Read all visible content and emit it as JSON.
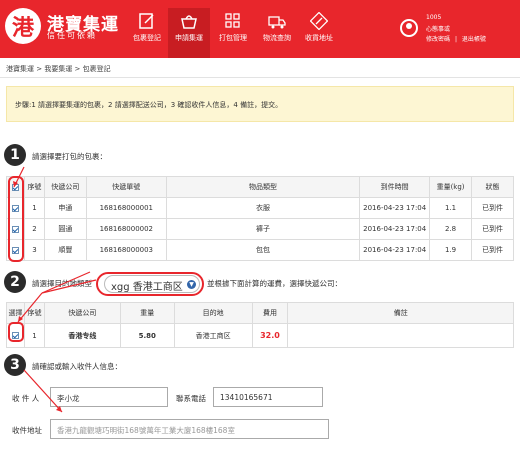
{
  "header": {
    "logo_glyph": "港",
    "logo_title": "港寶集運",
    "logo_subtitle": "信任可依賴",
    "nav": [
      {
        "label": "包裹登記",
        "icon": "edit-icon"
      },
      {
        "label": "申請集運",
        "icon": "basket-icon",
        "active": true
      },
      {
        "label": "打包管理",
        "icon": "grid-icon"
      },
      {
        "label": "物流查詢",
        "icon": "truck-icon"
      },
      {
        "label": "收貨地址",
        "icon": "address-icon"
      }
    ],
    "user": {
      "id": "1005",
      "name": "心態事或",
      "edit_link": "修改密碼",
      "separator": "|",
      "logout_link": "退出帳號"
    }
  },
  "breadcrumb": "港寶集運 > 我要集運 > 包裹登記",
  "notice": "步驟:1 請選擇要集運的包裹，2 請選擇配送公司，3 確認收件人信息，4 備註，提交。",
  "step1": {
    "number": "1",
    "title": "請選擇要打包的包裹：",
    "columns": [
      "",
      "序號",
      "快遞公司",
      "快遞單號",
      "物品類型",
      "到件時間",
      "重量(kg)",
      "狀態"
    ],
    "rows": [
      {
        "checked": true,
        "seq": "1",
        "company": "申通",
        "tracking": "168168000001",
        "type": "衣服",
        "time": "2016-04-23 17:04",
        "weight": "1.1",
        "status": "已到件"
      },
      {
        "checked": true,
        "seq": "2",
        "company": "圓通",
        "tracking": "168168000002",
        "type": "褲子",
        "time": "2016-04-23 17:04",
        "weight": "2.8",
        "status": "已到件"
      },
      {
        "checked": true,
        "seq": "3",
        "company": "順豐",
        "tracking": "168168000003",
        "type": "包包",
        "time": "2016-04-23 17:04",
        "weight": "1.9",
        "status": "已到件"
      }
    ]
  },
  "step2": {
    "number": "2",
    "title_prefix": "請選擇目的地類型",
    "select_value": "xgg 香港工商区",
    "title_suffix": "並根據下面計算的運費，選擇快遞公司：",
    "columns": [
      "選擇",
      "序號",
      "快遞公司",
      "重量",
      "目的地",
      "費用",
      "備註"
    ],
    "rows": [
      {
        "checked": true,
        "seq": "1",
        "company": "香港专线",
        "weight": "5.80",
        "destination": "香港工商区",
        "fee": "32.0",
        "note": ""
      }
    ]
  },
  "step3": {
    "number": "3",
    "title": "請確認或輸入收件人信息：",
    "recipient_label": "收 件 人",
    "recipient_value": "李小龙",
    "phone_label": "聯系電話",
    "phone_value": "13410165671",
    "address_label": "收件地址",
    "address_placeholder": "香港九龍觀塘巧明街168號萬年工業大廈168樓168室"
  },
  "colors": {
    "brand_red": "#e8262c",
    "fee_red": "#e8262c",
    "notice_bg": "#fdf6d3"
  }
}
